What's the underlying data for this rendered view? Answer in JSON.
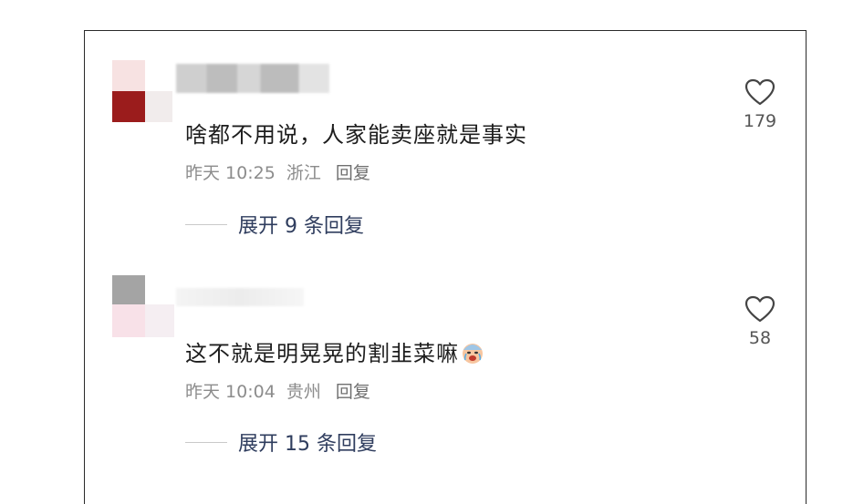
{
  "comments": [
    {
      "text": "啥都不用说，人家能卖座就是事实",
      "time": "昨天 10:25",
      "location": "浙江",
      "reply_label": "回复",
      "expand_label": "展开 9 条回复",
      "likes": "179",
      "avatar_colors": [
        "#f7e4e4",
        "#9b1c1c",
        "#efe9e9"
      ]
    },
    {
      "text": "这不就是明晃晃的割韭菜嘛",
      "time": "昨天 10:04",
      "location": "贵州",
      "reply_label": "回复",
      "expand_label": "展开 15 条回复",
      "likes": "58",
      "emoji": "crying-laughing-emoji",
      "avatar_colors": [
        "#a4a4a4",
        "#f8e1e8",
        "#f5eef2"
      ]
    }
  ],
  "icons": {
    "like": "heart-outline-icon"
  }
}
